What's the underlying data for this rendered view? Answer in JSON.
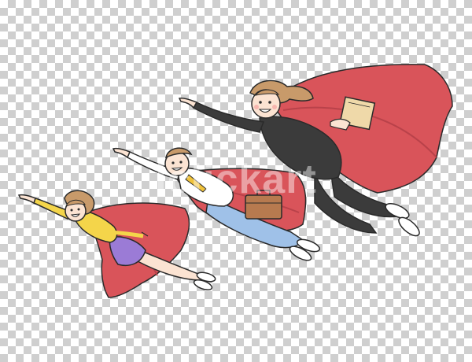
{
  "watermark": {
    "text": "iclickart"
  },
  "colors": {
    "cape": "#d9545a",
    "cape_dark": "#b9424a",
    "outline": "#2a2a2a",
    "skin": "#fbe3d2",
    "hair": "#c89a6a",
    "suit": "#3b3b3b",
    "shirt_white": "#ffffff",
    "tie": "#f0c23a",
    "jeans": "#9fc1e8",
    "sweater_yellow": "#f4d54a",
    "skirt_purple": "#9b7bd6",
    "briefcase": "#b77a4f",
    "book": "#efd9a9"
  },
  "figures": [
    {
      "name": "woman-in-suit-hero",
      "icon": "book-icon"
    },
    {
      "name": "man-in-shirt-hero",
      "icon": "briefcase-icon"
    },
    {
      "name": "girl-in-sweater-hero",
      "icon": ""
    }
  ]
}
